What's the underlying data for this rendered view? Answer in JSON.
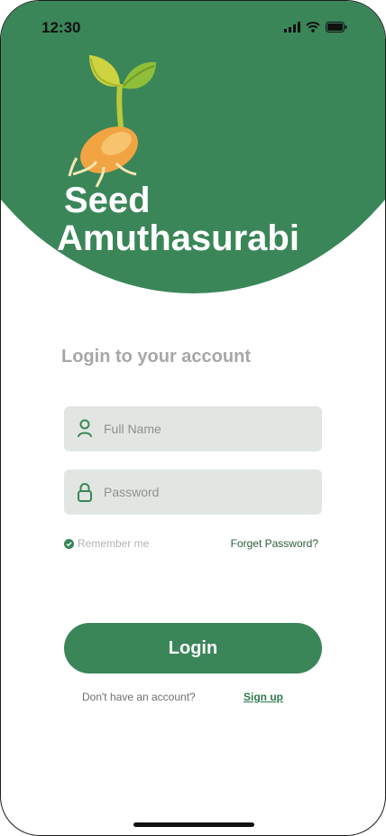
{
  "status_bar": {
    "time": "12:30"
  },
  "brand": {
    "line1": "Seed",
    "line2": "Amuthasurabi"
  },
  "login": {
    "heading": "Login to your account",
    "full_name_placeholder": "Full Name",
    "password_placeholder": "Password",
    "remember_label": "Remember me",
    "forgot_label": "Forget Password?",
    "button_label": "Login",
    "no_account_text": "Don't have an account?",
    "signup_label": "Sign up"
  },
  "colors": {
    "brand_green": "#3a8659",
    "field_bg": "#e1e6e2",
    "heading_gray": "#a7a7a7"
  },
  "icons": [
    "signal-icon",
    "wifi-icon",
    "battery-icon",
    "seed-sprout-icon",
    "user-icon",
    "lock-icon",
    "check-circle-icon"
  ]
}
